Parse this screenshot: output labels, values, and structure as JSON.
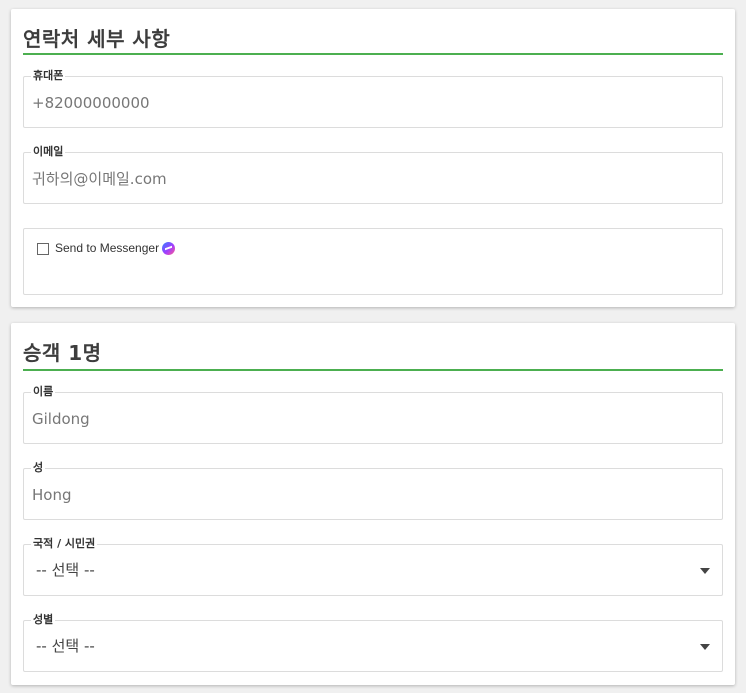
{
  "contact": {
    "title": "연락처 세부 사항",
    "phone": {
      "label": "휴대폰",
      "placeholder": "+82000000000"
    },
    "email": {
      "label": "이메일",
      "placeholder": "귀하의@이메일.com"
    },
    "messenger": {
      "label": "Send to Messenger",
      "checked": false
    }
  },
  "passenger": {
    "title": "승객 1명",
    "first_name": {
      "label": "이름",
      "placeholder": "Gildong"
    },
    "last_name": {
      "label": "성",
      "placeholder": "Hong"
    },
    "nationality": {
      "label": "국적 / 시민권",
      "selected": "-- 선택 --"
    },
    "gender": {
      "label": "성별",
      "selected": "-- 선택 --"
    }
  },
  "colors": {
    "accent": "#4caf50"
  }
}
